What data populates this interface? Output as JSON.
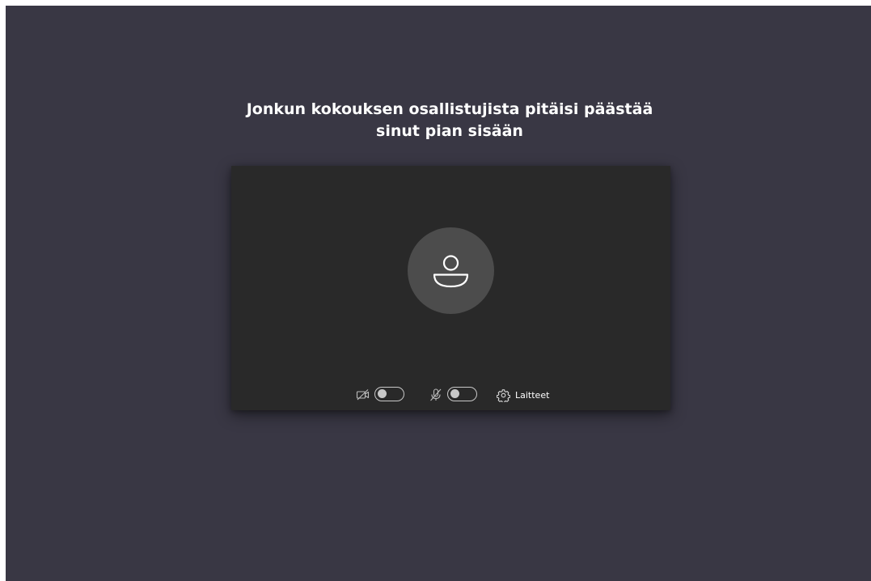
{
  "lobby": {
    "message_line1": "Jonkun kokouksen osallistujista pitäisi päästää",
    "message_line2": "sinut pian sisään"
  },
  "preview": {
    "avatar_icon": "person-icon",
    "camera": {
      "icon": "camera-off-icon",
      "enabled": false
    },
    "microphone": {
      "icon": "mic-off-icon",
      "enabled": false
    },
    "devices": {
      "icon": "gear-icon",
      "label": "Laitteet"
    }
  },
  "colors": {
    "background": "#393744",
    "preview_background": "#292929",
    "avatar_background": "#4c4c4c",
    "text": "#ffffff",
    "control": "#c8c8c8"
  }
}
